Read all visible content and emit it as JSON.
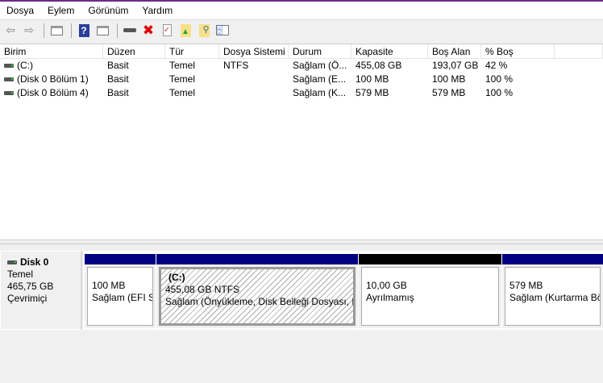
{
  "menu": [
    "Dosya",
    "Eylem",
    "Görünüm",
    "Yardım"
  ],
  "toolbar": [
    "back-icon",
    "forward-icon",
    "console-tree-icon",
    "help-icon",
    "action-pane-icon",
    "connect-disk-icon",
    "delete-icon",
    "properties-icon",
    "open-folder-icon",
    "explore-icon",
    "checklist-icon"
  ],
  "columns": [
    "Birim",
    "Düzen",
    "Tür",
    "Dosya Sistemi",
    "Durum",
    "Kapasite",
    "Boş Alan",
    "% Boş",
    ""
  ],
  "rows": [
    [
      "(C:)",
      "Basit",
      "Temel",
      "NTFS",
      "Sağlam (Ö...",
      "455,08 GB",
      "193,07 GB",
      "42 %"
    ],
    [
      "(Disk 0 Bölüm 1)",
      "Basit",
      "Temel",
      "",
      "Sağlam (E...",
      "100 MB",
      "100 MB",
      "100 %"
    ],
    [
      "(Disk 0 Bölüm 4)",
      "Basit",
      "Temel",
      "",
      "Sağlam (K...",
      "579 MB",
      "579 MB",
      "100 %"
    ]
  ],
  "disk": {
    "name": "Disk 0",
    "type": "Temel",
    "size": "465,75 GB",
    "status": "Çevrimiçi"
  },
  "partitions": [
    {
      "name": "",
      "size": "100 MB",
      "status": "Sağlam (EFI Sistem Bölümü)",
      "bar_color": "#000080"
    },
    {
      "name": "(C:)",
      "size": "455,08 GB NTFS",
      "status": "Sağlam (Önyükleme, Disk Belleği Dosyası, Kilitlenme Dökümü)",
      "bar_color": "#000080"
    },
    {
      "name": "",
      "size": "10,00 GB",
      "status": "Ayrılmamış",
      "bar_color": "#000000"
    },
    {
      "name": "",
      "size": "579 MB",
      "status": "Sağlam (Kurtarma Bölümü)",
      "bar_color": "#000080"
    }
  ]
}
